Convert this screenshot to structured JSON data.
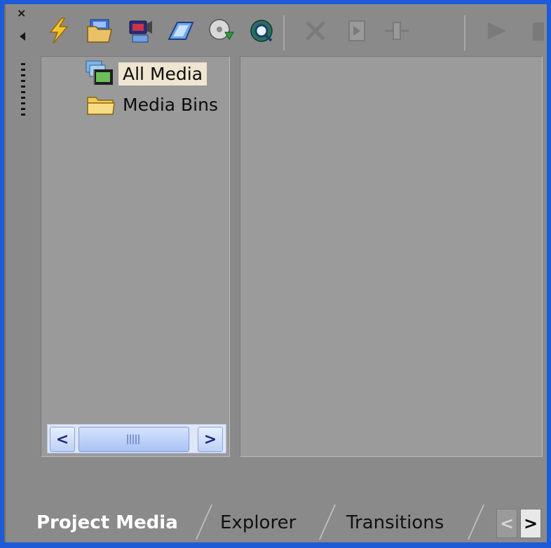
{
  "window": {
    "close_glyph": "×",
    "collapse_icon": "triangle-left-icon"
  },
  "toolbar": {
    "buttons": [
      {
        "name": "lightning-icon",
        "enabled": true
      },
      {
        "name": "import-media-icon",
        "enabled": true
      },
      {
        "name": "capture-video-icon",
        "enabled": true
      },
      {
        "name": "get-photo-icon",
        "enabled": true
      },
      {
        "name": "extract-audio-cd-icon",
        "enabled": true
      },
      {
        "name": "search-media-icon",
        "enabled": true
      },
      {
        "name": "remove-icon",
        "enabled": false
      },
      {
        "name": "media-fx-icon",
        "enabled": false
      },
      {
        "name": "split-icon",
        "enabled": false
      },
      {
        "name": "play-icon",
        "enabled": false
      },
      {
        "name": "stop-icon",
        "enabled": false
      }
    ]
  },
  "tree": {
    "items": [
      {
        "label": "All Media",
        "icon": "all-media-icon",
        "selected": true
      },
      {
        "label": "Media Bins",
        "icon": "folder-icon",
        "selected": false
      }
    ]
  },
  "scrollbar": {
    "left_glyph": "<",
    "right_glyph": ">"
  },
  "tabs": {
    "items": [
      {
        "label": "Project Media",
        "active": true
      },
      {
        "label": "Explorer",
        "active": false
      },
      {
        "label": "Transitions",
        "active": false
      }
    ],
    "prev_glyph": "<",
    "next_glyph": ">"
  },
  "colors": {
    "frame_border": "#1f5bd8",
    "panel_bg": "#8a8a8a",
    "selection": "#eee6d0"
  }
}
